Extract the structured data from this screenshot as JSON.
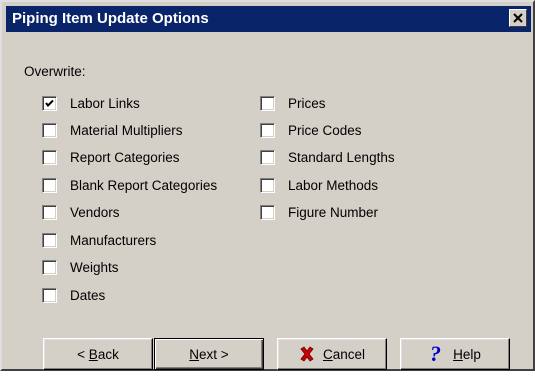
{
  "window": {
    "title": "Piping Item Update Options",
    "close_glyph": "×"
  },
  "overwrite": {
    "label": "Overwrite:",
    "left_column": [
      {
        "label": "Labor Links",
        "checked": true
      },
      {
        "label": "Material Multipliers",
        "checked": false
      },
      {
        "label": "Report Categories",
        "checked": false
      },
      {
        "label": "Blank Report Categories",
        "checked": false
      },
      {
        "label": "Vendors",
        "checked": false
      },
      {
        "label": "Manufacturers",
        "checked": false
      },
      {
        "label": "Weights",
        "checked": false
      },
      {
        "label": "Dates",
        "checked": false
      }
    ],
    "right_column": [
      {
        "label": "Prices",
        "checked": false
      },
      {
        "label": "Price Codes",
        "checked": false
      },
      {
        "label": "Standard Lengths",
        "checked": false
      },
      {
        "label": "Labor Methods",
        "checked": false
      },
      {
        "label": "Figure Number",
        "checked": false
      }
    ]
  },
  "buttons": {
    "back": {
      "label": "< Back",
      "mnemonic": "B"
    },
    "next": {
      "label": "Next >",
      "mnemonic": "N"
    },
    "cancel": {
      "label": "Cancel",
      "mnemonic": "C",
      "icon": "red-x-icon"
    },
    "help": {
      "label": "Help",
      "mnemonic": "H",
      "icon": "question-mark-icon"
    }
  },
  "colors": {
    "titlebar": "#0a246a",
    "dialog_face": "#d4d0c8",
    "cancel_icon": "#cc0000",
    "help_icon": "#0000cc"
  }
}
